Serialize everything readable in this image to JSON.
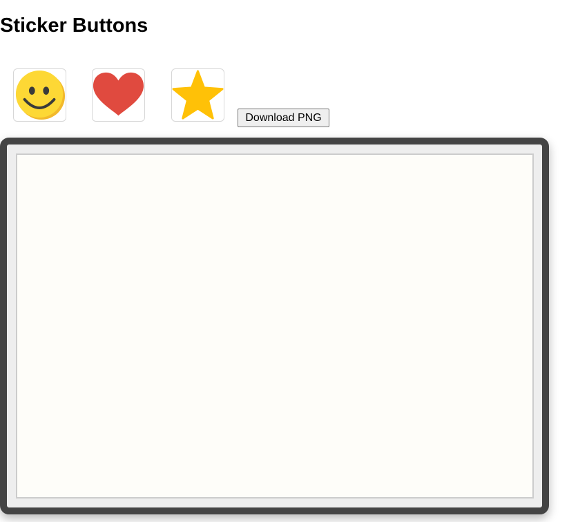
{
  "page": {
    "title": "Sticker Buttons"
  },
  "stickers": [
    {
      "icon": "smiley-face-icon",
      "color": "#fdd835"
    },
    {
      "icon": "heart-icon",
      "color": "#e04a3f"
    },
    {
      "icon": "star-icon",
      "color": "#ffc107"
    }
  ],
  "toolbar": {
    "download_label": "Download PNG"
  },
  "colors": {
    "frame_border": "#444444",
    "frame_background": "#eeeeee",
    "canvas_background": "#fefdf9",
    "canvas_border": "#cccccc"
  }
}
